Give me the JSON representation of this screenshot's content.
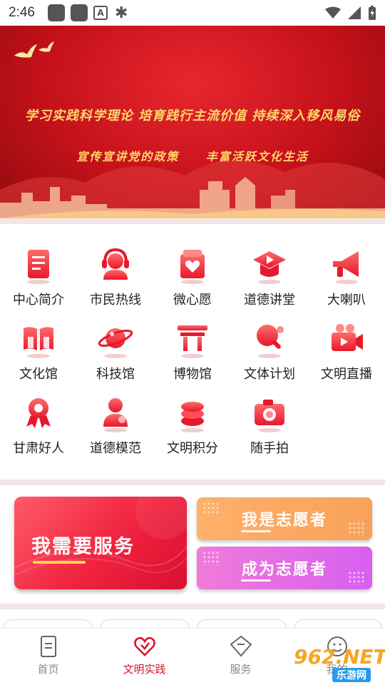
{
  "status_bar": {
    "time": "2:46"
  },
  "banner": {
    "line1": "学习实践科学理论 培育践行主流价值 持续深入移风易俗",
    "line2": "宣传宣讲党的政策 丰富活跃文化生活"
  },
  "grid": {
    "items": [
      {
        "label": "中心简介",
        "icon": "document-icon"
      },
      {
        "label": "市民热线",
        "icon": "headset-icon"
      },
      {
        "label": "微心愿",
        "icon": "heart-gift-icon"
      },
      {
        "label": "道德讲堂",
        "icon": "graduation-play-icon"
      },
      {
        "label": "大喇叭",
        "icon": "megaphone-icon"
      },
      {
        "label": "文化馆",
        "icon": "open-book-icon"
      },
      {
        "label": "科技馆",
        "icon": "planet-icon"
      },
      {
        "label": "博物馆",
        "icon": "museum-gate-icon"
      },
      {
        "label": "文体计划",
        "icon": "table-tennis-icon"
      },
      {
        "label": "文明直播",
        "icon": "video-camera-icon"
      },
      {
        "label": "甘肃好人",
        "icon": "medal-icon"
      },
      {
        "label": "道德模范",
        "icon": "person-badge-icon"
      },
      {
        "label": "文明积分",
        "icon": "coin-stack-icon"
      },
      {
        "label": "随手拍",
        "icon": "camera-icon"
      }
    ]
  },
  "services": {
    "need_service": "我需要服务",
    "i_am_volunteer": "我是志愿者",
    "become_volunteer": "成为志愿者"
  },
  "bottom_nav": {
    "items": [
      {
        "label": "首页",
        "icon": "home-doc-icon"
      },
      {
        "label": "文明实践",
        "icon": "heart-icon"
      },
      {
        "label": "服务",
        "icon": "diamond-service-icon"
      },
      {
        "label": "我的",
        "icon": "profile-icon"
      }
    ]
  },
  "watermark": {
    "main": "962.NET",
    "sub": "乐游网"
  },
  "colors": {
    "brand_red": "#d8162a",
    "banner_red": "#c4111a",
    "gold": "#ffd76a"
  }
}
